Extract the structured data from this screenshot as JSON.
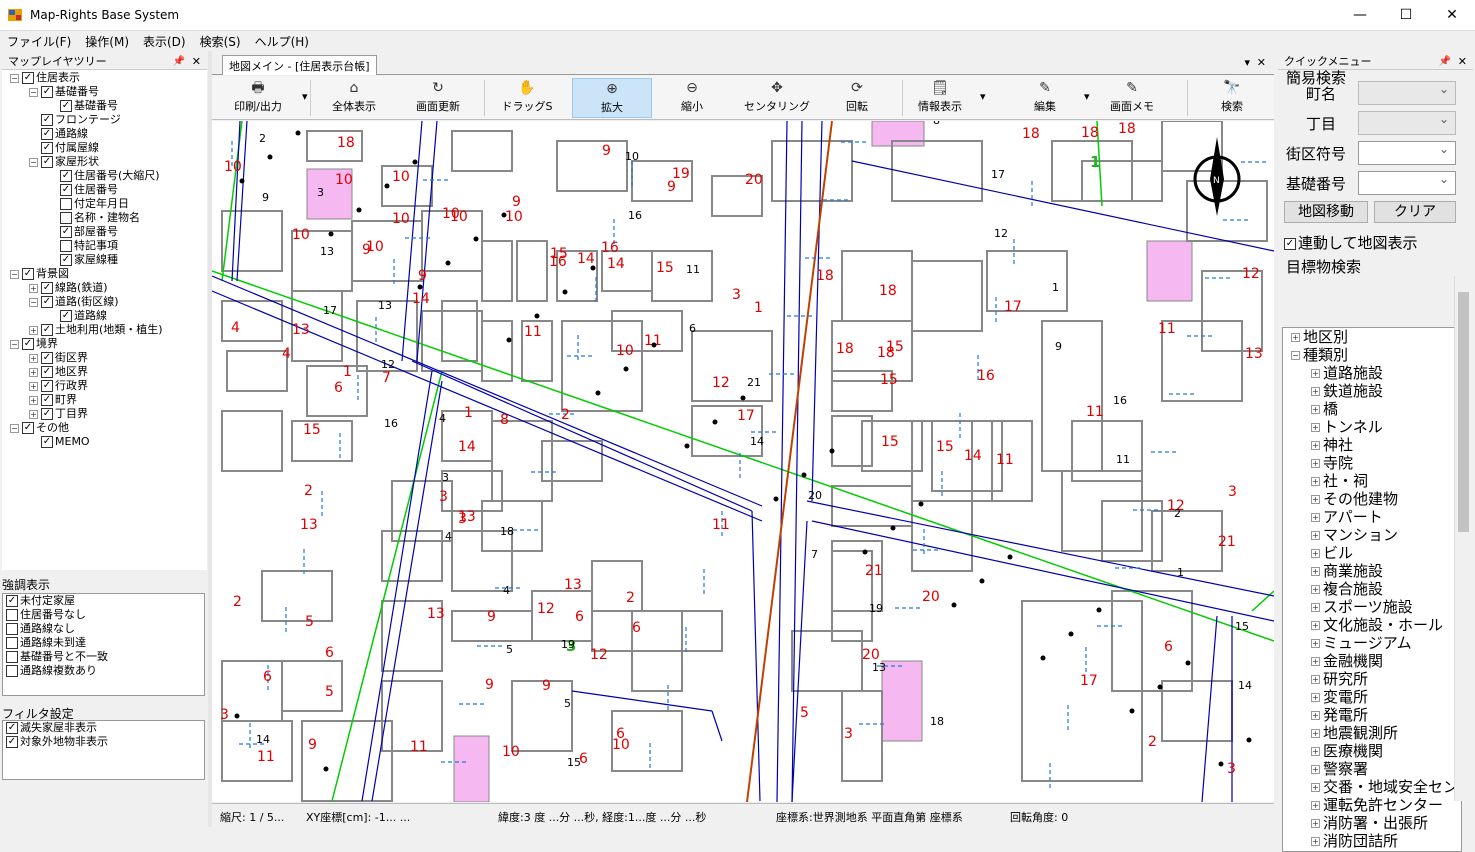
{
  "app": {
    "title": "Map-Rights Base System"
  },
  "window": {
    "minimize": "—",
    "maximize": "☐",
    "close": "✕"
  },
  "menu": [
    "ファイル(F)",
    "操作(M)",
    "表示(D)",
    "検索(S)",
    "ヘルプ(H)"
  ],
  "layer_tree": {
    "title": "マップレイヤツリー",
    "items": [
      {
        "label": "住居表示",
        "level": 0,
        "exp": "−",
        "checked": true
      },
      {
        "label": "基礎番号",
        "level": 1,
        "exp": "−",
        "checked": true
      },
      {
        "label": "基礎番号",
        "level": 2,
        "exp": "",
        "checked": true
      },
      {
        "label": "フロンテージ",
        "level": 1,
        "exp": "",
        "checked": true
      },
      {
        "label": "通路線",
        "level": 1,
        "exp": "",
        "checked": true
      },
      {
        "label": "付属屋線",
        "level": 1,
        "exp": "",
        "checked": true
      },
      {
        "label": "家屋形状",
        "level": 1,
        "exp": "−",
        "checked": true
      },
      {
        "label": "住居番号(大縮尺)",
        "level": 2,
        "exp": "",
        "checked": true
      },
      {
        "label": "住居番号",
        "level": 2,
        "exp": "",
        "checked": true
      },
      {
        "label": "付定年月日",
        "level": 2,
        "exp": "",
        "checked": false
      },
      {
        "label": "名称・建物名",
        "level": 2,
        "exp": "",
        "checked": false
      },
      {
        "label": "部屋番号",
        "level": 2,
        "exp": "",
        "checked": true
      },
      {
        "label": "特記事項",
        "level": 2,
        "exp": "",
        "checked": false
      },
      {
        "label": "家屋線種",
        "level": 2,
        "exp": "",
        "checked": true
      },
      {
        "label": "背景図",
        "level": 0,
        "exp": "−",
        "checked": true
      },
      {
        "label": "線路(鉄道)",
        "level": 1,
        "exp": "+",
        "checked": true
      },
      {
        "label": "道路(街区線)",
        "level": 1,
        "exp": "−",
        "checked": true
      },
      {
        "label": "道路線",
        "level": 2,
        "exp": "",
        "checked": true
      },
      {
        "label": "土地利用(地類・植生)",
        "level": 1,
        "exp": "+",
        "checked": true
      },
      {
        "label": "境界",
        "level": 0,
        "exp": "−",
        "checked": true
      },
      {
        "label": "街区界",
        "level": 1,
        "exp": "+",
        "checked": true
      },
      {
        "label": "地区界",
        "level": 1,
        "exp": "+",
        "checked": true
      },
      {
        "label": "行政界",
        "level": 1,
        "exp": "+",
        "checked": true
      },
      {
        "label": "町界",
        "level": 1,
        "exp": "+",
        "checked": true
      },
      {
        "label": "丁目界",
        "level": 1,
        "exp": "+",
        "checked": true
      },
      {
        "label": "その他",
        "level": 0,
        "exp": "−",
        "checked": true
      },
      {
        "label": "MEMO",
        "level": 1,
        "exp": "",
        "checked": true
      }
    ]
  },
  "highlight": {
    "title": "強調表示",
    "items": [
      {
        "label": "未付定家屋",
        "checked": true
      },
      {
        "label": "住居番号なし",
        "checked": false
      },
      {
        "label": "通路線なし",
        "checked": false
      },
      {
        "label": "通路線未到達",
        "checked": false
      },
      {
        "label": "基礎番号と不一致",
        "checked": false
      },
      {
        "label": "通路線複数あり",
        "checked": false
      }
    ]
  },
  "filter": {
    "title": "フィルタ設定",
    "items": [
      {
        "label": "滅失家屋非表示",
        "checked": true
      },
      {
        "label": "対象外地物非表示",
        "checked": true
      }
    ]
  },
  "tab": {
    "label": "地図メイン - [住居表示台帳]",
    "pin": "▾",
    "close": "✕"
  },
  "toolbar": [
    {
      "label": "印刷/出力",
      "icon": "🖶",
      "dd": true
    },
    {
      "label": "全体表示",
      "icon": "⌂"
    },
    {
      "label": "画面更新",
      "icon": "↻"
    },
    {
      "label": "ドラッグS",
      "icon": "✋"
    },
    {
      "label": "拡大",
      "icon": "⊕",
      "active": true
    },
    {
      "label": "縮小",
      "icon": "⊖"
    },
    {
      "label": "センタリング",
      "icon": "✥"
    },
    {
      "label": "回転",
      "icon": "⟳"
    },
    {
      "label": "情報表示",
      "icon": "🗒",
      "dd": true
    },
    {
      "label": "編集",
      "icon": "✎",
      "dd": true
    },
    {
      "label": "画面メモ",
      "icon": "✎"
    },
    {
      "label": "検索",
      "icon": "🔭"
    }
  ],
  "map": {
    "labels": [
      "10",
      "18",
      "10",
      "10",
      "9",
      "9",
      "19",
      "20",
      "9",
      "1",
      "18",
      "18",
      "18",
      "10",
      "10",
      "10",
      "10",
      "10",
      "10",
      "9",
      "9",
      "16",
      "16",
      "15",
      "15",
      "14",
      "14",
      "14",
      "13",
      "10",
      "11",
      "11",
      "10",
      "3",
      "4",
      "4",
      "6",
      "7",
      "1",
      "15",
      "14",
      "1",
      "2",
      "3",
      "3",
      "13",
      "8",
      "13",
      "13",
      "2",
      "5",
      "9",
      "13",
      "12",
      "6",
      "6",
      "6",
      "5",
      "9",
      "9",
      "12",
      "6",
      "6",
      "6",
      "10",
      "9",
      "11",
      "11",
      "10",
      "3",
      "12",
      "2",
      "11",
      "17",
      "18",
      "18",
      "18",
      "18",
      "15",
      "17",
      "16",
      "15",
      "15",
      "15",
      "14",
      "11",
      "11",
      "11",
      "13",
      "12",
      "12",
      "3",
      "21",
      "2",
      "21",
      "20",
      "20",
      "5",
      "3",
      "6",
      "17",
      "2",
      "3"
    ],
    "green_labels": [
      "1",
      "3"
    ],
    "road_numbers": [
      "9",
      "17",
      "16",
      "4",
      "5",
      "15",
      "16",
      "6",
      "14",
      "7",
      "13",
      "8",
      "12",
      "9",
      "11",
      "1",
      "14",
      "2",
      "13",
      "12",
      "3",
      "4",
      "5",
      "10",
      "11",
      "21",
      "20",
      "19",
      "18",
      "17",
      "1",
      "16",
      "2",
      "15",
      "14",
      "3",
      "13",
      "4",
      "18",
      "19"
    ],
    "compass": "N"
  },
  "status": {
    "scale": "縮尺: 1 / 5...",
    "xy": "XY座標[cm]: -1... ...",
    "latlng": "緯度:3 度 ...分 ...秒, 経度:1...度 ...分 ...秒",
    "crs": "座標系:世界測地系 平面直角第  座標系",
    "rot": "回転角度: 0"
  },
  "quick": {
    "title": "クイックメニュー",
    "simple": "簡易検索",
    "fields": [
      {
        "label": "町名",
        "disabled": true
      },
      {
        "label": "丁目",
        "disabled": true
      },
      {
        "label": "街区符号",
        "disabled": false
      },
      {
        "label": "基礎番号",
        "disabled": false
      }
    ],
    "move_btn": "地図移動",
    "clear_btn": "クリア",
    "sync_label": "連動して地図表示",
    "target_title": "目標物検索",
    "tree": [
      {
        "label": "地区別",
        "exp": "+",
        "level": 0
      },
      {
        "label": "種類別",
        "exp": "−",
        "level": 0
      },
      {
        "label": "道路施設",
        "exp": "+",
        "level": 1
      },
      {
        "label": "鉄道施設",
        "exp": "+",
        "level": 1
      },
      {
        "label": "橋",
        "exp": "+",
        "level": 1
      },
      {
        "label": "トンネル",
        "exp": "+",
        "level": 1
      },
      {
        "label": "神社",
        "exp": "+",
        "level": 1
      },
      {
        "label": "寺院",
        "exp": "+",
        "level": 1
      },
      {
        "label": "社・祠",
        "exp": "+",
        "level": 1
      },
      {
        "label": "その他建物",
        "exp": "+",
        "level": 1
      },
      {
        "label": "アパート",
        "exp": "+",
        "level": 1
      },
      {
        "label": "マンション",
        "exp": "+",
        "level": 1
      },
      {
        "label": "ビル",
        "exp": "+",
        "level": 1
      },
      {
        "label": "商業施設",
        "exp": "+",
        "level": 1
      },
      {
        "label": "複合施設",
        "exp": "+",
        "level": 1
      },
      {
        "label": "スポーツ施設",
        "exp": "+",
        "level": 1
      },
      {
        "label": "文化施設・ホール",
        "exp": "+",
        "level": 1
      },
      {
        "label": "ミュージアム",
        "exp": "+",
        "level": 1
      },
      {
        "label": "金融機関",
        "exp": "+",
        "level": 1
      },
      {
        "label": "研究所",
        "exp": "+",
        "level": 1
      },
      {
        "label": "変電所",
        "exp": "+",
        "level": 1
      },
      {
        "label": "発電所",
        "exp": "+",
        "level": 1
      },
      {
        "label": "地震観測所",
        "exp": "+",
        "level": 1
      },
      {
        "label": "医療機関",
        "exp": "+",
        "level": 1
      },
      {
        "label": "警察署",
        "exp": "+",
        "level": 1
      },
      {
        "label": "交番・地域安全セン",
        "exp": "+",
        "level": 1
      },
      {
        "label": "運転免許センター",
        "exp": "+",
        "level": 1
      },
      {
        "label": "消防署・出張所",
        "exp": "+",
        "level": 1
      },
      {
        "label": "消防団詰所",
        "exp": "+",
        "level": 1
      }
    ]
  },
  "colors": {
    "label_red": "#e00000",
    "road_blue": "#0000b0",
    "boundary_green": "#00cc00",
    "rail": "#c04000",
    "pink": "#f5b8f0"
  }
}
